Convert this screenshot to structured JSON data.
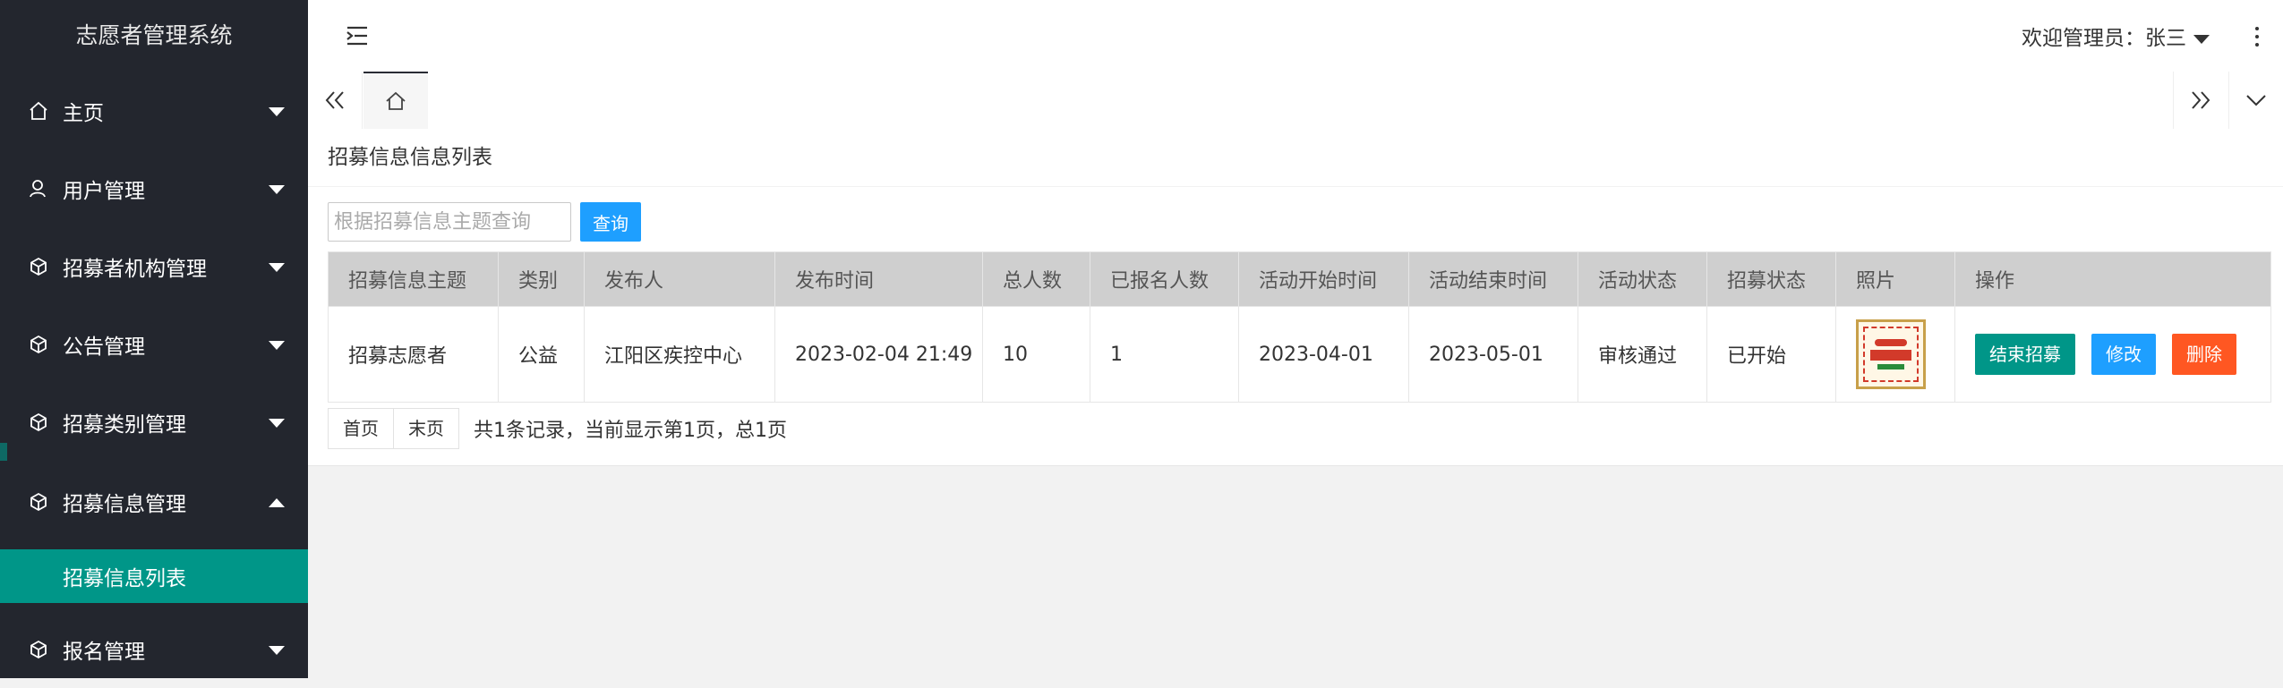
{
  "app": {
    "title": "志愿者管理系统"
  },
  "sidebar": {
    "items": [
      {
        "label": "主页"
      },
      {
        "label": "用户管理"
      },
      {
        "label": "招募者机构管理"
      },
      {
        "label": "公告管理"
      },
      {
        "label": "招募类别管理"
      },
      {
        "label": "招募信息管理"
      },
      {
        "label": "报名管理"
      }
    ],
    "sub_item": {
      "label": "招募信息列表"
    }
  },
  "header": {
    "welcome": "欢迎管理员：张三"
  },
  "page": {
    "title": "招募信息信息列表",
    "search": {
      "placeholder": "根据招募信息主题查询",
      "value": "",
      "button": "查询"
    },
    "table": {
      "columns": [
        "招募信息主题",
        "类别",
        "发布人",
        "发布时间",
        "总人数",
        "已报名人数",
        "活动开始时间",
        "活动结束时间",
        "活动状态",
        "招募状态",
        "照片",
        "操作"
      ],
      "rows": [
        {
          "topic": "招募志愿者",
          "category": "公益",
          "publisher": "江阳区疾控中心",
          "publish_time": "2023-02-04 21:49",
          "total": "10",
          "registered": "1",
          "start": "2023-04-01",
          "end": "2023-05-01",
          "activity_status": "审核通过",
          "recruit_status": "已开始",
          "actions": {
            "end": "结束招募",
            "edit": "修改",
            "delete": "删除"
          }
        }
      ]
    },
    "pager": {
      "first": "首页",
      "last": "末页",
      "info": "共1条记录，当前显示第1页，总1页"
    }
  },
  "colors": {
    "sidebar_bg": "#23262e",
    "accent": "#009688",
    "primary": "#1e9fff",
    "danger": "#ff5722"
  }
}
